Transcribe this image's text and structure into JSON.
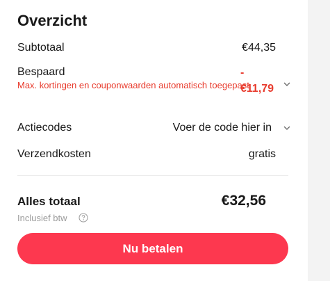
{
  "summary": {
    "title": "Overzicht",
    "subtotal": {
      "label": "Subtotaal",
      "value": "€44,35"
    },
    "saved": {
      "label": "Bespaard",
      "note": "Max. kortingen en couponwaarden automatisch toegepast",
      "sign": "-",
      "value": "€11,79"
    },
    "promo": {
      "label": "Actiecodes",
      "placeholder": "Voer de code hier in"
    },
    "shipping": {
      "label": "Verzendkosten",
      "value": "gratis"
    },
    "total": {
      "label": "Alles totaal",
      "value": "€32,56",
      "vat_note": "Inclusief btw"
    },
    "pay_button": "Nu betalen"
  },
  "icons": {
    "saved_expand": "chevron-down-icon",
    "promo_expand": "chevron-down-icon",
    "vat_help": "help-circle-icon"
  },
  "colors": {
    "accent": "#fd384f",
    "discount": "#e83a2c",
    "text": "#191919",
    "muted": "#9a9a9a"
  }
}
